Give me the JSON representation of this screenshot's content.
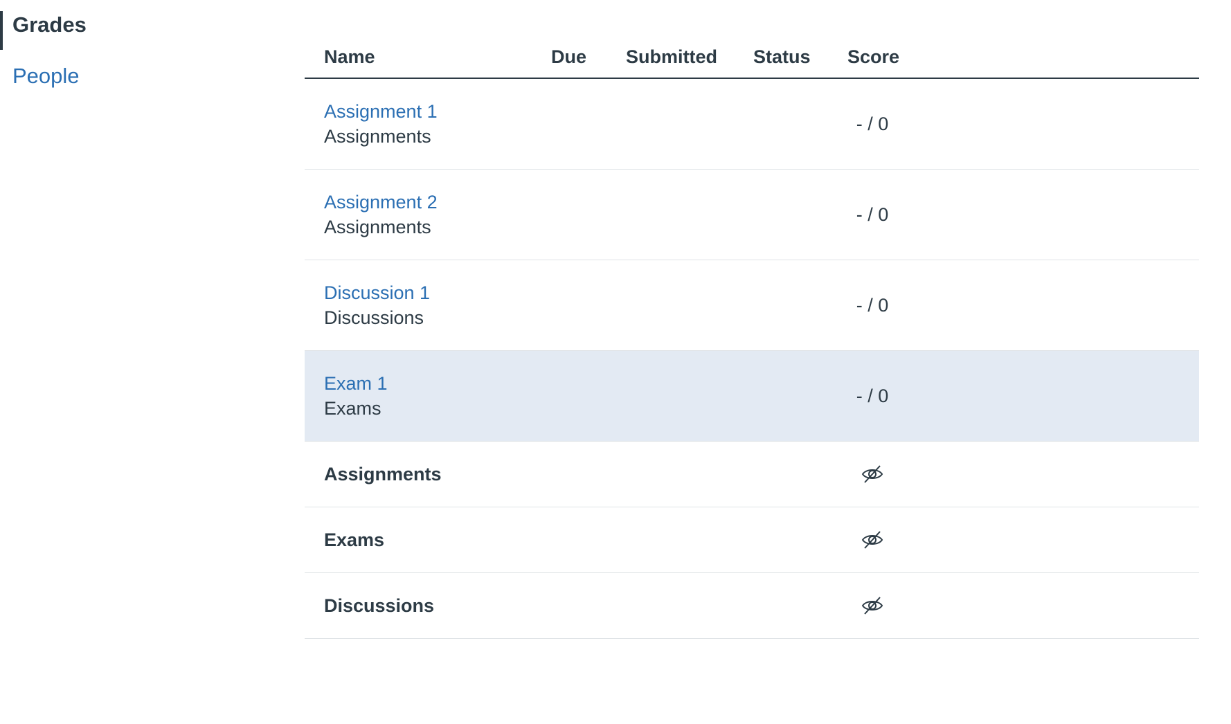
{
  "sidebar": {
    "items": [
      {
        "label": "Grades",
        "active": true
      },
      {
        "label": "People",
        "active": false
      }
    ]
  },
  "table": {
    "headers": {
      "name": "Name",
      "due": "Due",
      "submitted": "Submitted",
      "status": "Status",
      "score": "Score"
    },
    "items": [
      {
        "title": "Assignment 1",
        "category": "Assignments",
        "due": "",
        "submitted": "",
        "status": "",
        "score": "- / 0"
      },
      {
        "title": "Assignment 2",
        "category": "Assignments",
        "due": "",
        "submitted": "",
        "status": "",
        "score": "- / 0"
      },
      {
        "title": "Discussion 1",
        "category": "Discussions",
        "due": "",
        "submitted": "",
        "status": "",
        "score": "- / 0"
      },
      {
        "title": "Exam 1",
        "category": "Exams",
        "due": "",
        "submitted": "",
        "status": "",
        "score": "- / 0"
      }
    ],
    "groups": [
      {
        "title": "Assignments",
        "score_icon": "eye-hidden-icon"
      },
      {
        "title": "Exams",
        "score_icon": "eye-hidden-icon"
      },
      {
        "title": "Discussions",
        "score_icon": "eye-hidden-icon"
      }
    ]
  },
  "colors": {
    "link": "#2b6fb3",
    "text": "#2d3b45",
    "row_highlight": "#e3eaf3",
    "divider": "#dfe3e6"
  }
}
